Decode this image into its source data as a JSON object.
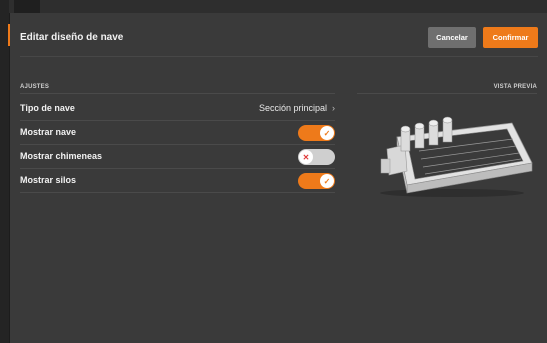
{
  "dialog": {
    "title": "Editar diseño de nave",
    "cancel_label": "Cancelar",
    "confirm_label": "Confirmar"
  },
  "settings": {
    "section_label": "AJUSTES",
    "rows": [
      {
        "label": "Tipo de nave",
        "value": "Sección principal",
        "icon": "chevron-right-icon"
      },
      {
        "label": "Mostrar nave",
        "toggle": true,
        "icon": "check-icon"
      },
      {
        "label": "Mostrar chimeneas",
        "toggle": false,
        "icon": "x-icon"
      },
      {
        "label": "Mostrar silos",
        "toggle": true,
        "icon": "check-icon"
      }
    ]
  },
  "preview": {
    "section_label": "VISTA PREVIA",
    "image": "barn-3d-model"
  },
  "colors": {
    "accent": "#ee7a1a",
    "panel": "#3a3a3a",
    "cancel": "#6f6f6f",
    "toggle_off": "#cfcfcf",
    "x_icon": "#e03a3a"
  }
}
